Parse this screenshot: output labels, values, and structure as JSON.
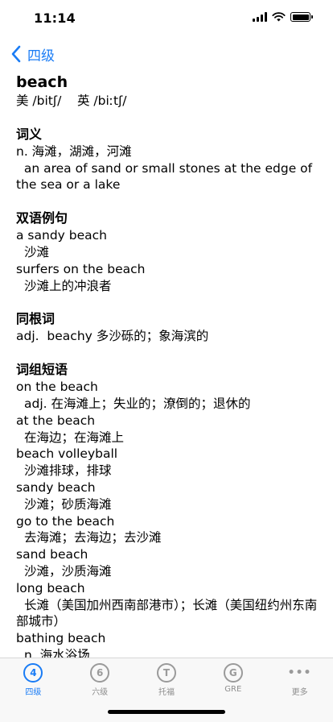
{
  "status_bar": {
    "time": "11:14"
  },
  "nav": {
    "back_label": "四级"
  },
  "entry": {
    "word": "beach",
    "phonetic": "美 /bitʃ/    英 /biːtʃ/"
  },
  "definition": {
    "title": "词义",
    "pos_line": "n. 海滩，湖滩，河滩",
    "english": "  an area of sand or small stones at the edge of the sea or a lake"
  },
  "examples": {
    "title": "双语例句",
    "items": [
      {
        "en": "a sandy beach",
        "zh": "沙滩"
      },
      {
        "en": "surfers on the beach",
        "zh": "沙滩上的冲浪者"
      }
    ]
  },
  "cognates": {
    "title": "同根词",
    "line": "adj.  beachy 多沙砾的；象海滨的"
  },
  "phrases": {
    "title": "词组短语",
    "items": [
      {
        "en": "on the beach",
        "zh": "adj. 在海滩上；失业的；潦倒的；退休的"
      },
      {
        "en": "at the beach",
        "zh": "在海边；在海滩上"
      },
      {
        "en": "beach volleyball",
        "zh": "沙滩排球，排球"
      },
      {
        "en": "sandy beach",
        "zh": "沙滩；砂质海滩"
      },
      {
        "en": "go to the beach",
        "zh": "去海滩；去海边；去沙滩"
      },
      {
        "en": "sand beach",
        "zh": "沙滩，沙质海滩"
      },
      {
        "en": "long beach",
        "zh": "长滩（美国加州西南部港市）；长滩（美国纽约州东南部城市）"
      },
      {
        "en": "bathing beach",
        "zh": "n. 海水浴场"
      }
    ]
  },
  "tabs": [
    {
      "icon_text": "4",
      "label": "四级",
      "icon_name": "cet4-icon",
      "active": true
    },
    {
      "icon_text": "6",
      "label": "六级",
      "icon_name": "cet6-icon",
      "active": false
    },
    {
      "icon_text": "T",
      "label": "托福",
      "icon_name": "toefl-icon",
      "active": false
    },
    {
      "icon_text": "G",
      "label": "GRE",
      "icon_name": "gre-icon",
      "active": false
    },
    {
      "icon_text": "•••",
      "label": "更多",
      "icon_name": "more-icon",
      "active": false
    }
  ],
  "colors": {
    "accent": "#1a7cf5",
    "inactive": "#9a9a9a"
  }
}
